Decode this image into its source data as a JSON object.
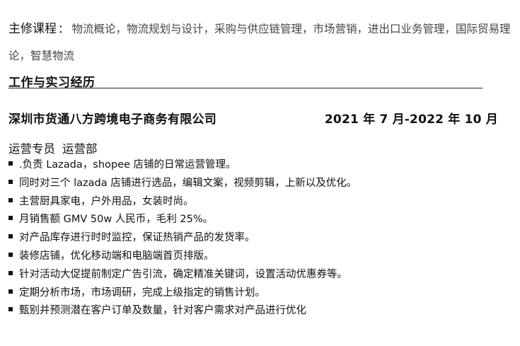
{
  "education": {
    "courses_label": "主修课程",
    "courses_colon": "：",
    "courses_text": "物流概论，物流规划与设计，采购与供应链管理，市场营销，进出口业务管理，国际贸易理论，智慧物流"
  },
  "experience": {
    "section_title": "工作与实习经历",
    "company": "深圳市货通八方跨境电子商务有限公司",
    "period": "2021 年 7 月-2022 年 10 月",
    "position": "运营专员",
    "department": "运营部",
    "duties": [
      ".负责 Lazada，shopee 店铺的日常运营管理。",
      "同时对三个 lazada 店铺进行选品，编辑文案，视频剪辑，上新以及优化。",
      "主营厨具家电，户外用品，女装时尚。",
      "月销售额 GMV 50w 人民币，毛利 25%。",
      "对产品库存进行时时监控，保证热销产品的发货率。",
      "装修店铺，优化移动端和电脑端首页排版。",
      "针对活动大促提前制定广告引流，确定精准关键词，设置活动优惠券等。",
      "定期分析市场，市场调研，完成上级指定的销售计划。",
      "甄别并预测潜在客户订单及数量，针对客户需求对产品进行优化"
    ]
  }
}
